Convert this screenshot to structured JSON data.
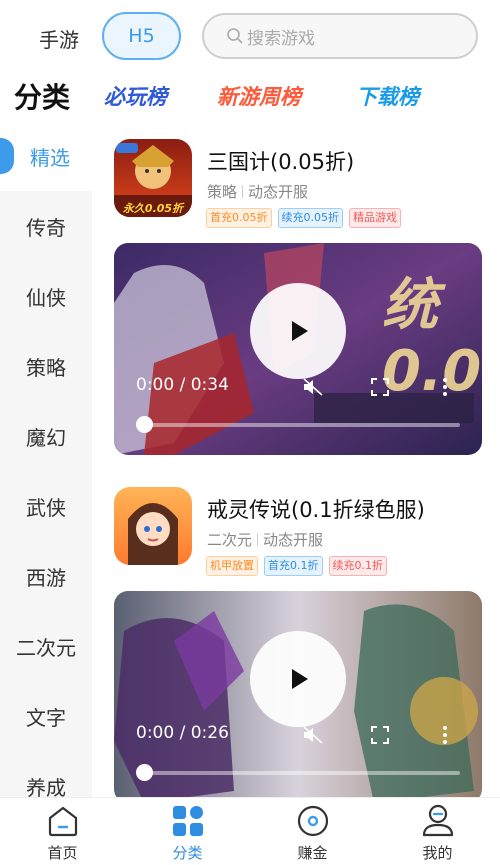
{
  "topbar": {
    "tab_shouyou": "手游",
    "tab_h5": "H5",
    "search_placeholder": "搜索游戏"
  },
  "category_header": {
    "title": "分类",
    "rankings": [
      "必玩榜",
      "新游周榜",
      "下载榜"
    ]
  },
  "sidebar": {
    "items": [
      {
        "label": "精选",
        "active": true
      },
      {
        "label": "传奇"
      },
      {
        "label": "仙侠"
      },
      {
        "label": "策略"
      },
      {
        "label": "魔幻"
      },
      {
        "label": "武侠"
      },
      {
        "label": "西游"
      },
      {
        "label": "二次元"
      },
      {
        "label": "文字"
      },
      {
        "label": "养成"
      }
    ]
  },
  "games": [
    {
      "name": "三国计(0.05折)",
      "genre": "策略",
      "server": "动态开服",
      "icon_badge": "永久0.05折",
      "tags": [
        {
          "text": "首充0.05折",
          "color": "orange"
        },
        {
          "text": "续充0.05折",
          "color": "blue"
        },
        {
          "text": "精品游戏",
          "color": "red"
        }
      ],
      "video": {
        "time": "0:00 / 0:34",
        "progress": 0,
        "overlay_text": "统 0.0"
      }
    },
    {
      "name": "戒灵传说(0.1折绿色服)",
      "genre": "二次元",
      "server": "动态开服",
      "tags": [
        {
          "text": "机甲放置",
          "color": "orange"
        },
        {
          "text": "首充0.1折",
          "color": "blue"
        },
        {
          "text": "续充0.1折",
          "color": "red"
        }
      ],
      "video": {
        "time": "0:00 / 0:26",
        "progress": 0
      }
    }
  ],
  "bottom_nav": {
    "items": [
      {
        "label": "首页",
        "icon": "home-icon"
      },
      {
        "label": "分类",
        "icon": "category-icon",
        "active": true
      },
      {
        "label": "赚金",
        "icon": "coin-icon"
      },
      {
        "label": "我的",
        "icon": "user-icon"
      }
    ]
  },
  "colors": {
    "accent": "#3d9be9",
    "nav_active": "#2e8de0",
    "rank_1": "#2e59d9",
    "rank_2": "#ff5a3a",
    "rank_3": "#1a9be8"
  }
}
